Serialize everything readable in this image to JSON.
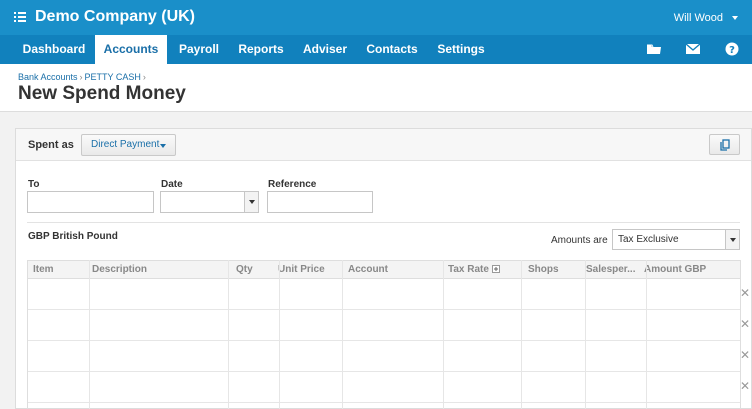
{
  "topbar": {
    "org_name": "Demo Company (UK)",
    "user_name": "Will Wood",
    "org_icon": "org-menu-icon"
  },
  "nav": {
    "tabs": [
      {
        "label": "Dashboard",
        "active": false
      },
      {
        "label": "Accounts",
        "active": true
      },
      {
        "label": "Payroll",
        "active": false
      },
      {
        "label": "Reports",
        "active": false
      },
      {
        "label": "Adviser",
        "active": false
      },
      {
        "label": "Contacts",
        "active": false
      },
      {
        "label": "Settings",
        "active": false
      }
    ],
    "icons": [
      "folder-icon",
      "mail-icon",
      "help-icon"
    ]
  },
  "breadcrumb": {
    "items": [
      "Bank Accounts",
      "PETTY CASH"
    ],
    "separator": "›"
  },
  "page_title": "New Spend Money",
  "form": {
    "spent_as_label": "Spent as",
    "spent_as_value": "Direct Payment",
    "to_label": "To",
    "to_value": "",
    "date_label": "Date",
    "date_value": "",
    "reference_label": "Reference",
    "reference_value": "",
    "currency": "GBP British Pound",
    "amounts_are_label": "Amounts are",
    "amounts_are_value": "Tax Exclusive"
  },
  "table": {
    "columns": [
      "Item",
      "Description",
      "Qty",
      "Unit Price",
      "Account",
      "Tax Rate",
      "Shops",
      "Salesper...",
      "Amount GBP"
    ],
    "rows": [
      [
        "",
        "",
        "",
        "",
        "",
        "",
        "",
        "",
        ""
      ],
      [
        "",
        "",
        "",
        "",
        "",
        "",
        "",
        "",
        ""
      ],
      [
        "",
        "",
        "",
        "",
        "",
        "",
        "",
        "",
        ""
      ],
      [
        "",
        "",
        "",
        "",
        "",
        "",
        "",
        "",
        ""
      ]
    ],
    "delete_symbol": "✕"
  },
  "colors": {
    "topbar": "#1a8fc9",
    "nav": "#1181bd",
    "link": "#1a6fa8"
  }
}
